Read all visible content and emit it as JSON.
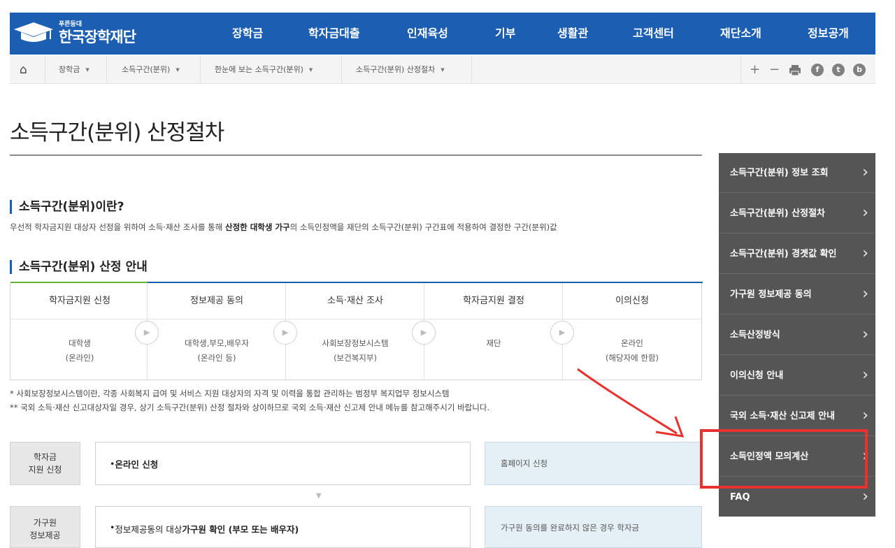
{
  "header": {
    "logo_small": "푸른등대",
    "logo_name": "한국장학재단",
    "nav": [
      "장학금",
      "학자금대출",
      "인재육성",
      "기부",
      "생활관",
      "고객센터",
      "재단소개",
      "정보공개"
    ]
  },
  "breadcrumb": {
    "items": [
      "장학금",
      "소득구간(분위)",
      "한눈에 보는 소득구간(분위)",
      "소득구간(분위) 산정절차"
    ],
    "tools": [
      "+",
      "−"
    ],
    "social": [
      "f",
      "t",
      "b"
    ]
  },
  "page": {
    "title": "소득구간(분위) 산정절차",
    "section1_title": "소득구간(분위)이란?",
    "section1_desc_a": "우선적 학자금지원 대상자 선정을 위하여 소득·재산 조사를 통해 ",
    "section1_desc_b": "산정한 대학생 가구",
    "section1_desc_c": "의 소득인정액을 재단의 소득구간(분위) 구간표에 적용하여 결정한 구간(분위)값",
    "section2_title": "소득구간(분위) 산정 안내"
  },
  "process": [
    {
      "head": "학자금지원 신청",
      "line1": "대학생",
      "line2": "(온라인)"
    },
    {
      "head": "정보제공 동의",
      "line1": "대학생,부모,배우자",
      "line2": "(온라인 등)"
    },
    {
      "head": "소득·재산 조사",
      "line1": "사회보장정보시스템",
      "line2": "(보건복지부)"
    },
    {
      "head": "학자금지원 결정",
      "line1": "재단",
      "line2": ""
    },
    {
      "head": "이의신청",
      "line1": "온라인",
      "line2": "(해당자에 한함)"
    }
  ],
  "notes": [
    "* 사회보장정보시스템이란, 각종 사회복지 급여 및 서비스 지원 대상자의 자격 및 이력을 통합 관리하는 범정부 복지업무 정보시스템",
    "** 국외 소득·재산 신고대상자일 경우, 상기 소득구간(분위) 산정 절차와 상이하므로 국외 소득·재산 신고제 안내 메뉴를 참고해주시기 바랍니다."
  ],
  "steps": [
    {
      "label_1": "학자금",
      "label_2": "지원 신청",
      "bullet": "• ",
      "text": "온라인 신청",
      "text_b": "",
      "text_c": "",
      "right": "홈페이지 신청"
    },
    {
      "label_1": "가구원",
      "label_2": "정보제공",
      "bullet": "• ",
      "text": "정보제공동의 대상 ",
      "text_b": "가구원 확인 (부모 또는 배우자)",
      "text_c": "",
      "right": "가구원 동의를 완료하지 않은 경우 학자금"
    }
  ],
  "side_menu": [
    "소득구간(분위) 정보 조회",
    "소득구간(분위) 산정절차",
    "소득구간(분위) 경곗값 확인",
    "가구원 정보제공 동의",
    "소득산정방식",
    "이의신청 안내",
    "국외 소득·재산 신고제 안내",
    "소득인정액 모의계산",
    "FAQ"
  ],
  "colors": {
    "header_blue": "#1b5eb2",
    "side_gray": "#555555",
    "highlight_red": "#e8322e",
    "step_blue_bg": "#e4f0f5"
  }
}
